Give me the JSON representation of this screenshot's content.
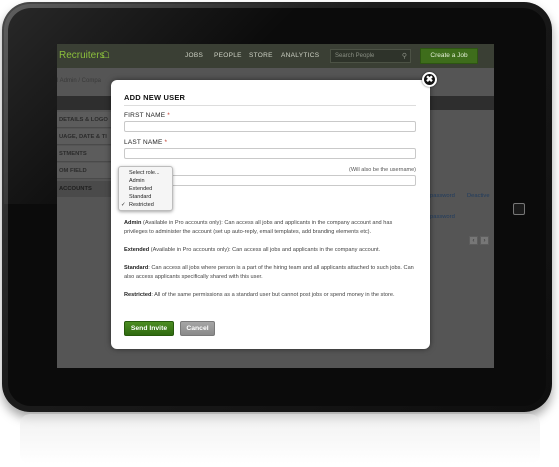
{
  "app": {
    "logo": "Recruiters",
    "nav": [
      "JOBS",
      "PEOPLE",
      "STORE",
      "ANALYTICS"
    ],
    "search_placeholder": "Search People",
    "create_job": "Create a Job"
  },
  "breadcrumb": "l Admin  /  Compa",
  "sidebar": [
    "DETAILS & LOGO",
    "UAGE, DATE & TI",
    "STMENTS",
    "OM FIELD",
    "ACCOUNTS"
  ],
  "right_links": [
    "password",
    "Deactive",
    "password"
  ],
  "modal": {
    "title": "ADD NEW USER",
    "first_name_label": "FIRST NAME",
    "last_name_label": "LAST NAME",
    "required_mark": "*",
    "email_hint": "(Will also be the username)",
    "role_options": [
      "Select role...",
      "Admin",
      "Extended",
      "Standard",
      "Restricted"
    ],
    "selected_role": "Restricted",
    "checkmark": "✓",
    "descriptions": [
      {
        "name": "Admin",
        "text": " (Available in Pro accounts only): Can access all jobs and applicants in the company account and has privileges to administer the account (set up auto-reply, email templates, add branding elements etc)."
      },
      {
        "name": "Extended",
        "text": " (Available in Pro accounts only): Can access all jobs and applicants in the company account."
      },
      {
        "name": "Standard",
        "text": ": Can access all jobs where person is a part of the hiring team and all applicants attached to such jobs. Can also access applicants specifically shared with this user."
      },
      {
        "name": "Restricted",
        "text": ": All of the same permissions as a standard user but cannot post jobs or spend money in the store."
      }
    ],
    "send_button": "Send Invite",
    "cancel_button": "Cancel",
    "close_symbol": "✖"
  },
  "colors": {
    "accent_green": "#3e6d1b",
    "required_red": "#c0392b"
  }
}
